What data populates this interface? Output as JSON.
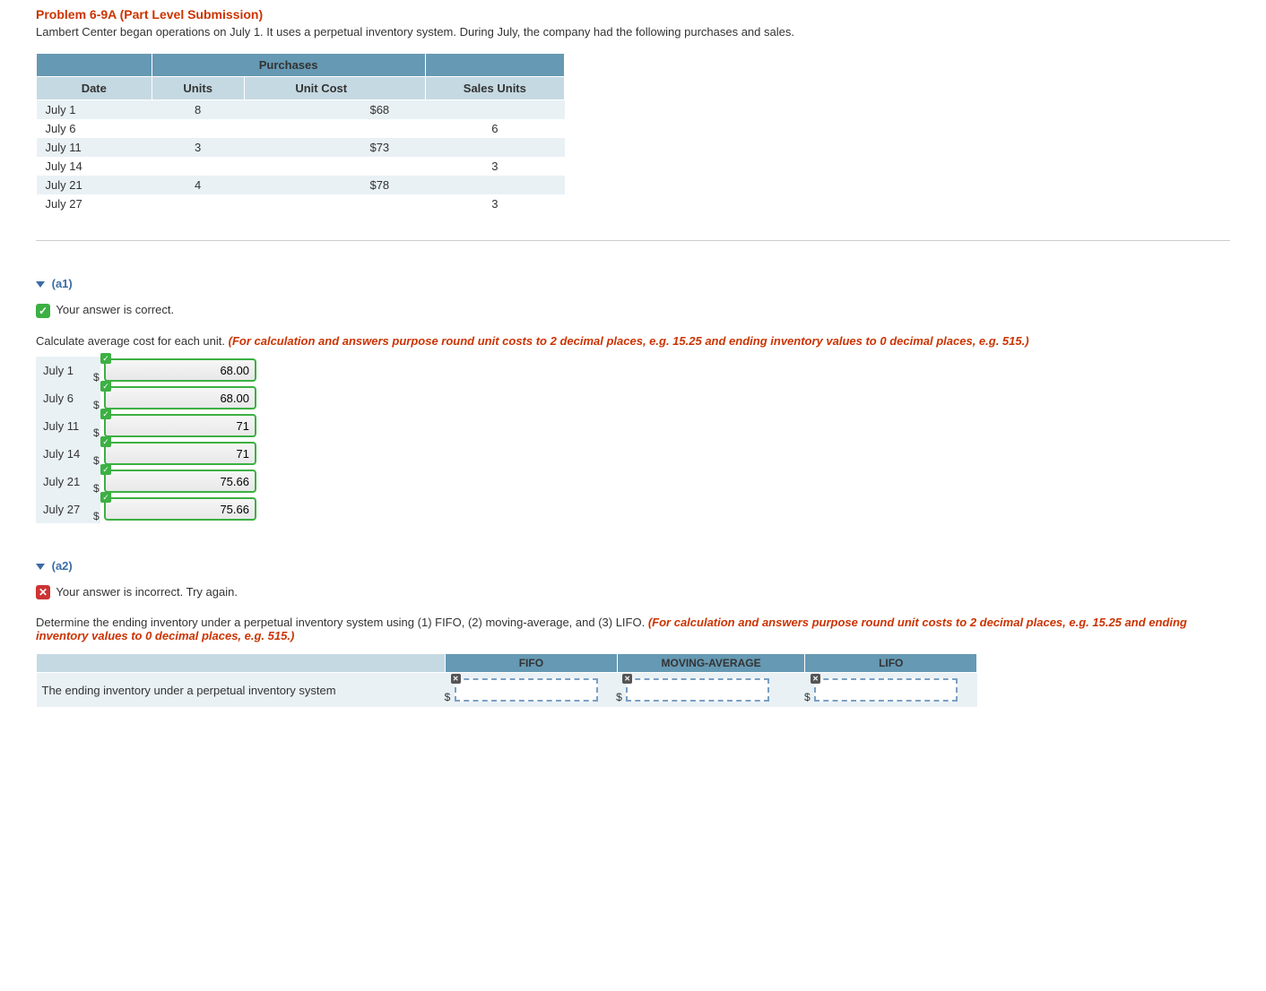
{
  "problem": {
    "title": "Problem 6-9A (Part Level Submission)",
    "intro": "Lambert Center began operations on July 1. It uses a perpetual inventory system. During July, the company had the following purchases and sales."
  },
  "table": {
    "purchases_header": "Purchases",
    "headers": {
      "date": "Date",
      "units": "Units",
      "unit_cost": "Unit Cost",
      "sales": "Sales Units"
    },
    "rows": [
      {
        "date": "July 1",
        "units": "8",
        "unit_cost": "$68",
        "sales": ""
      },
      {
        "date": "July 6",
        "units": "",
        "unit_cost": "",
        "sales": "6"
      },
      {
        "date": "July 11",
        "units": "3",
        "unit_cost": "$73",
        "sales": ""
      },
      {
        "date": "July 14",
        "units": "",
        "unit_cost": "",
        "sales": "3"
      },
      {
        "date": "July 21",
        "units": "4",
        "unit_cost": "$78",
        "sales": ""
      },
      {
        "date": "July 27",
        "units": "",
        "unit_cost": "",
        "sales": "3"
      }
    ]
  },
  "a1": {
    "label": "(a1)",
    "feedback": "Your answer is correct.",
    "question": "Calculate average cost for each unit. ",
    "hint": "(For calculation and answers purpose round unit costs to 2 decimal places, e.g. 15.25 and ending inventory values to 0 decimal places, e.g. 515.)",
    "answers": [
      {
        "label": "July 1",
        "value": "68.00"
      },
      {
        "label": "July 6",
        "value": "68.00"
      },
      {
        "label": "July 11",
        "value": "71"
      },
      {
        "label": "July 14",
        "value": "71"
      },
      {
        "label": "July 21",
        "value": "75.66"
      },
      {
        "label": "July 27",
        "value": "75.66"
      }
    ]
  },
  "a2": {
    "label": "(a2)",
    "feedback": "Your answer is incorrect.  Try again.",
    "question": "Determine the ending inventory under a perpetual inventory system using (1) FIFO, (2) moving-average, and (3) LIFO. ",
    "hint": "(For calculation and answers purpose round unit costs to 2 decimal places, e.g. 15.25 and ending inventory values to 0 decimal places, e.g. 515.)",
    "headers": {
      "fifo": "FIFO",
      "ma": "MOVING-AVERAGE",
      "lifo": "LIFO"
    },
    "row_label": "The ending inventory under a perpetual inventory system",
    "values": {
      "fifo": "",
      "ma": "",
      "lifo": ""
    }
  }
}
